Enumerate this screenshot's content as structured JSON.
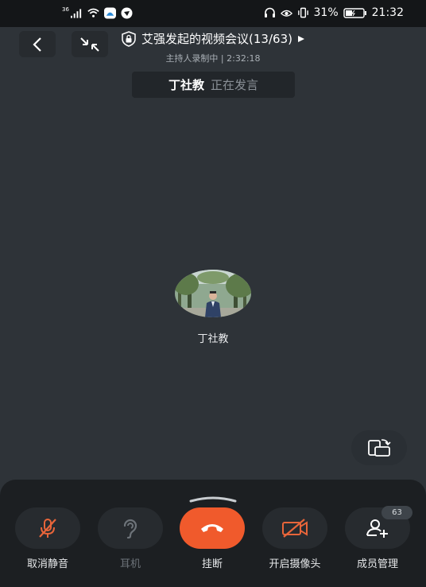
{
  "status_bar": {
    "network": "36",
    "battery": "31%",
    "time": "21:32"
  },
  "header": {
    "title": "艾强发起的视频会议(13/63)",
    "subtitle": "主持人录制中 | 2:32:18"
  },
  "speaker": {
    "name": "丁社教",
    "status": "正在发言"
  },
  "participant": {
    "name": "丁社教"
  },
  "controls": {
    "unmute": "取消静音",
    "earpiece": "耳机",
    "hangup": "挂断",
    "camera": "开启摄像头",
    "members": "成员管理",
    "members_count": "63"
  },
  "colors": {
    "background": "#2e3338",
    "panel": "#1c1f22",
    "hangup": "#f05a2c",
    "muted_icon": "#e8653a"
  }
}
